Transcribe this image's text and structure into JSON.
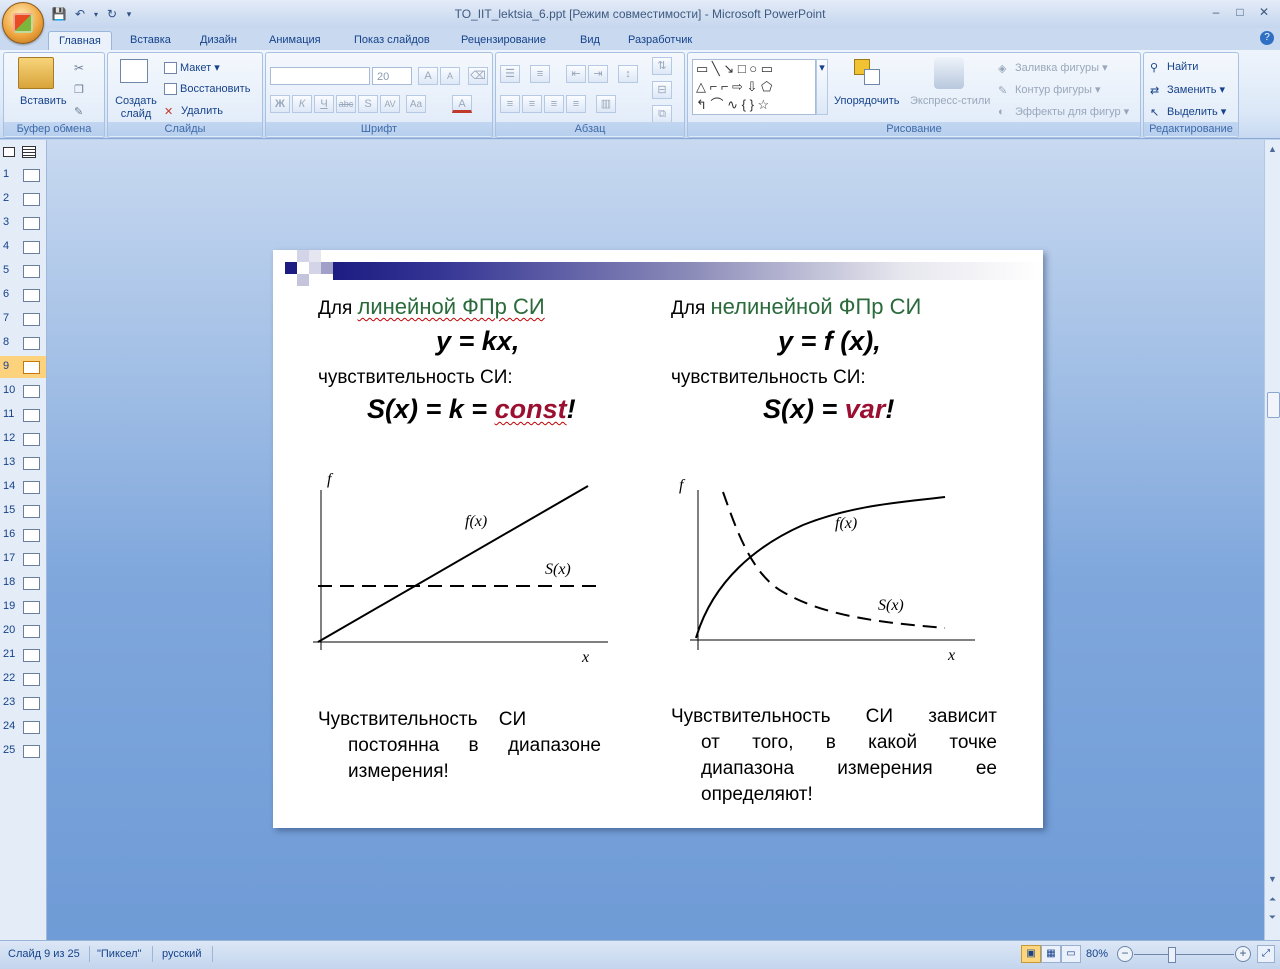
{
  "window": {
    "title": "TO_IIT_lektsia_6.ppt [Режим совместимости] - Microsoft PowerPoint",
    "controls": [
      "–",
      "□",
      "✕"
    ]
  },
  "tabs": [
    "Главная",
    "Вставка",
    "Дизайн",
    "Анимация",
    "Показ слайдов",
    "Рецензирование",
    "Вид",
    "Разработчик"
  ],
  "ribbon": {
    "clipboard": {
      "label": "Буфер обмена",
      "paste": "Вставить"
    },
    "slides": {
      "label": "Слайды",
      "new_slide": "Создать слайд",
      "layout": "Макет",
      "reset": "Восстановить",
      "delete": "Удалить"
    },
    "font": {
      "label": "Шрифт",
      "font_name": "",
      "font_size": "20"
    },
    "paragraph": {
      "label": "Абзац"
    },
    "drawing": {
      "label": "Рисование",
      "arrange": "Упорядочить",
      "quick_styles": "Экспресс-стили",
      "fill": "Заливка фигуры",
      "outline": "Контур фигуры",
      "effects": "Эффекты для фигур"
    },
    "editing": {
      "label": "Редактирование",
      "find": "Найти",
      "replace": "Заменить",
      "select": "Выделить"
    }
  },
  "slide_count": 25,
  "current_slide": 9,
  "slide": {
    "left": {
      "intro_prefix": "Для ",
      "intro_accent": "линейной ФПр СИ",
      "formula": "y = kx,",
      "sensitivity_label": "чувствительность СИ:",
      "s_formula_prefix": "S(x) = k = ",
      "s_formula_accent": "const",
      "s_formula_suffix": "!",
      "axis_f": "f",
      "axis_x": "x",
      "curve_f": "f(x)",
      "curve_s": "S(x)",
      "paragraph_1": "Чувствительность СИ",
      "paragraph_2": "постоянна в диапазоне",
      "paragraph_3": "измерения!"
    },
    "right": {
      "intro_prefix": "Для ",
      "intro_accent": "нелинейной ФПр СИ",
      "formula": "y = f (x),",
      "sensitivity_label": "чувствительность СИ:",
      "s_formula_prefix": "S(x) = ",
      "s_formula_accent": "var",
      "s_formula_suffix": "!",
      "axis_f": "f",
      "axis_x": "x",
      "curve_f": "f(x)",
      "curve_s": "S(x)",
      "paragraph_1": "Чувствительность СИ зависит",
      "paragraph_2": "от того, в какой точке",
      "paragraph_3": "диапазона измерения ее",
      "paragraph_4": "определяют!"
    }
  },
  "status": {
    "slide_info": "Слайд 9 из 25",
    "theme": "\"Пиксел\"",
    "language": "русский",
    "zoom": "80%"
  }
}
